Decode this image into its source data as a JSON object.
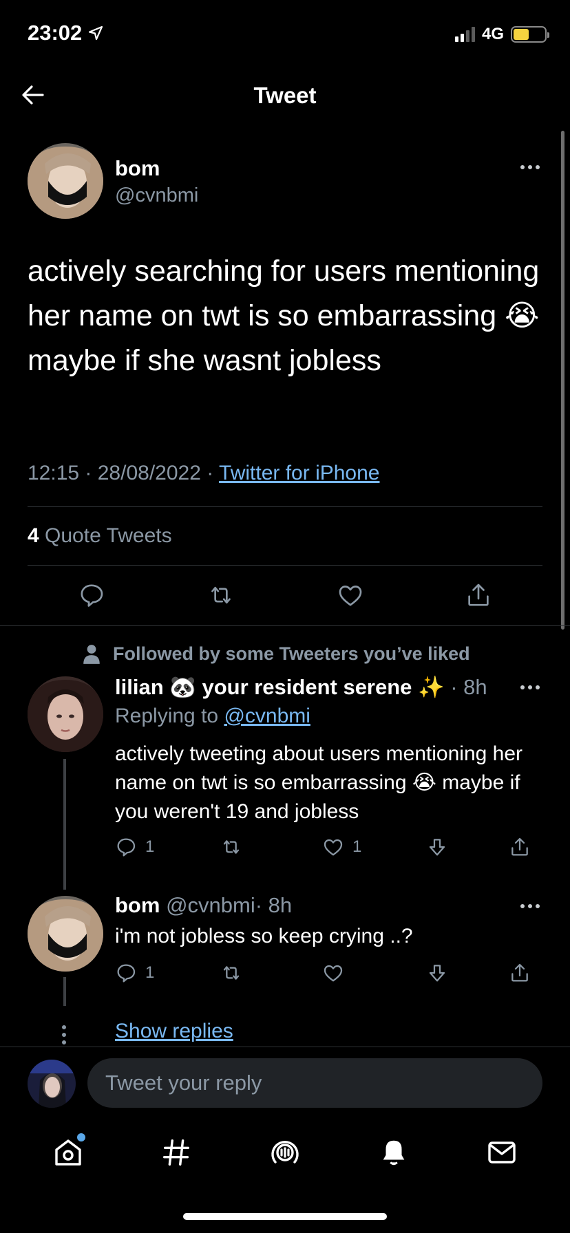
{
  "status_bar": {
    "time": "23:02",
    "network": "4G"
  },
  "header": {
    "title": "Tweet"
  },
  "main_tweet": {
    "author_name": "bom",
    "author_handle": "@cvnbmi",
    "text": "actively searching for users mentioning her name on twt is so embarrassing 😭 maybe if she wasnt jobless",
    "time": "12:15",
    "date": "28/08/2022",
    "source": "Twitter for iPhone",
    "quote_count": "4",
    "quote_label": "Quote Tweets"
  },
  "replies": [
    {
      "social_context": "Followed by some Tweeters you’ve liked",
      "author_name": "lilian 🐼 your resident serene ✨",
      "time": "· 8h",
      "replying_label": "Replying to",
      "replying_to": "@cvnbmi",
      "text": "actively tweeting about users mentioning her name on twt is so embarrassing 😭 maybe if you weren't 19 and jobless",
      "reply_count": "1",
      "retweet_count": "",
      "like_count": "1"
    },
    {
      "author_name": "bom",
      "author_handle": "@cvnbmi",
      "time": "· 8h",
      "text": "i'm not jobless so keep crying ..?",
      "reply_count": "1",
      "retweet_count": "",
      "like_count": ""
    }
  ],
  "show_replies": "Show replies",
  "composer": {
    "placeholder": "Tweet your reply"
  },
  "tabbar": {
    "items": [
      "home-icon",
      "explore-hashtag-icon",
      "spaces-icon",
      "notifications-bell-icon",
      "messages-mail-icon"
    ]
  },
  "colors": {
    "background": "#000000",
    "link": "#79b8f2",
    "muted": "#8b98a5",
    "battery": "#f5d33f"
  }
}
